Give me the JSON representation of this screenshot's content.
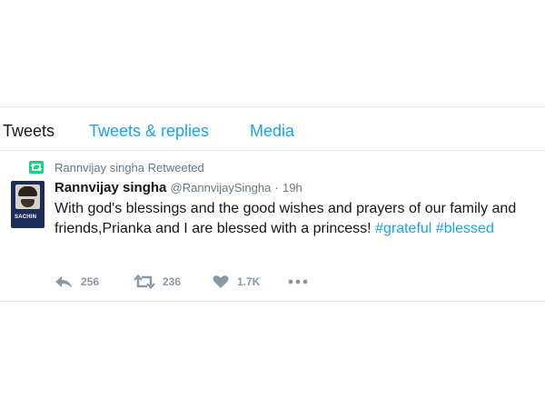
{
  "tabs": [
    {
      "label": "Tweets",
      "active": true
    },
    {
      "label": "Tweets & replies",
      "active": false
    },
    {
      "label": "Media",
      "active": false
    }
  ],
  "tweet": {
    "retweet_context": "Rannvijay singha Retweeted",
    "author": {
      "name": "Rannvijay singha",
      "handle": "@RannvijaySingha",
      "avatar_caption": "SACHIN"
    },
    "separator": "·",
    "time": "19h",
    "text_before": "With god's blessings and the good wishes and prayers of our family and friends,Prianka and I are blessed with a princess! ",
    "hashtags": [
      "#grateful",
      "#blessed"
    ],
    "actions": {
      "replies": "256",
      "retweets": "236",
      "likes": "1.7K",
      "more": "•••"
    }
  },
  "colors": {
    "link": "#1da1f2",
    "muted": "#657786",
    "icon": "#8899a6",
    "retweet_badge": "#19cf86",
    "border": "#e1e8ed"
  },
  "icons": {
    "retweet_context": "retweet-icon",
    "reply": "reply-icon",
    "retweet": "retweet-icon",
    "like": "heart-icon",
    "more": "more-dots-icon"
  }
}
